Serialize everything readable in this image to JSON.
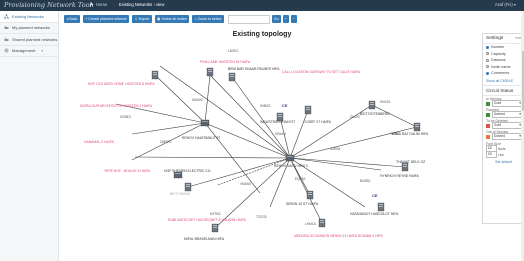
{
  "app": {
    "logo_text": "Provisioning Network Tool"
  },
  "header": {
    "home_label": "Home",
    "crumb_current": "Existing Networks › view",
    "user": "Asaf (Fix) ▾"
  },
  "sidebar": {
    "items": [
      {
        "label": "Existing Networks",
        "active": true
      },
      {
        "label": "My planned networks",
        "active": false
      },
      {
        "label": "Shared planned networks",
        "active": false
      },
      {
        "label": "Management",
        "active": false
      }
    ]
  },
  "toolbar": {
    "back_label": "Back",
    "create_label": "Create planned network",
    "export_label": "Export",
    "select_all_label": "Select all nodes",
    "zoom_label": "Zoom to select",
    "search_placeholder": "",
    "go_label": "Go"
  },
  "main": {
    "title": "Existing topology"
  },
  "settings": {
    "title": "Settings",
    "close_label": "hide",
    "options": [
      {
        "label": "Number",
        "selected": true
      },
      {
        "label": "Capacity",
        "selected": false
      },
      {
        "label": "Distance",
        "selected": false
      },
      {
        "label": "Node name",
        "selected": false
      },
      {
        "label": "Comments",
        "selected": true
      }
    ],
    "link_label": "Show all CMS/LE"
  },
  "circuit_status": {
    "title": "Circuit Status",
    "close_label": "hide",
    "rows": [
      {
        "label": "In Service",
        "color": "#3a8f3a",
        "value": "Solid"
      },
      {
        "label": "Planned",
        "color": "#3a8f3a",
        "value": "Dashed"
      },
      {
        "label": "To be Deleted",
        "color": "#d9534f",
        "value": "Solid"
      },
      {
        "label": "Out of Service",
        "color": "#e07b39",
        "value": "Dashed"
      }
    ],
    "font_size_label": "Font Size",
    "node_label": "Node",
    "node_size": "12",
    "link_label": "Link",
    "link_size": "10",
    "reset_label": "Set default"
  },
  "topology": {
    "nodes": [
      {
        "label": "BENI BAR SHAAR PALMER HIFA",
        "color": "#333"
      },
      {
        "label": "PINKL AME HASSTEN 54 HAIFA",
        "color": "#e0457b"
      },
      {
        "label": "CALL LOCATION GATEWAY TO SET CALIS HAIFA",
        "color": "#e0457b"
      },
      {
        "label": "NOF OLD AKED HOME HASSTEN 8 HAIFA",
        "color": "#e0457b"
      },
      {
        "label": "DIORA OUR ARCHITECTS HASSTEN 1 HAIFA",
        "color": "#e0457b"
      },
      {
        "label": "INDUSTRIES KHAYOT",
        "color": "#333"
      },
      {
        "label": "BEIT ROTENBERG",
        "color": "#333"
      },
      {
        "label": "ESED BAT DALIM HIFA",
        "color": "#333"
      },
      {
        "label": "YOSEF 27 HAIFA",
        "color": "#333"
      },
      {
        "label": "REHOV HAATSMAUT 57",
        "color": "#333"
      },
      {
        "label": "HANAMAL 2 HAIFA",
        "color": "#e0457b"
      },
      {
        "label": "THAWAT DELK OZ",
        "color": "#333"
      },
      {
        "label": "REHOV NATIV HEN 3",
        "color": "#333"
      },
      {
        "label": "YEFE NOF - BIYALIK 5 HAIFA",
        "color": "#e0457b"
      },
      {
        "label": "HOF SHEMEN ELECTRIC CO.",
        "color": "#333"
      },
      {
        "label": "HYNRICH HEYNE HAIFA",
        "color": "#333"
      },
      {
        "label": "SIRKIN 10 ST HAIFA",
        "color": "#333"
      },
      {
        "label": "HATAHANOT HASDOLOT HIFA",
        "color": "#333"
      },
      {
        "label": "BEIT HASAN",
        "color": "#aaa"
      },
      {
        "label": "RUBI MATECHET HACHEQNET 8 VOLANN HAIFA",
        "color": "#e0457b"
      },
      {
        "label": "MIFAL BRASELMAN HIFA",
        "color": "#333"
      },
      {
        "label": "MENORA DO AVANON SIRKIN 13 HAIFA DGANIM 4 HIFA",
        "color": "#e0457b"
      }
    ],
    "ce_label": "CE",
    "link_tags": [
      "LDSE2",
      "MDA53",
      "KNBS3",
      "ZHDS7",
      "HNX31",
      "TIKR4",
      "KGBE3",
      "OMSR0",
      "VMAS5",
      "EQFA9",
      "SUEB4",
      "TZOC8",
      "LHMC5",
      "MTRS2",
      "BUSB2",
      "GRAH1"
    ]
  }
}
